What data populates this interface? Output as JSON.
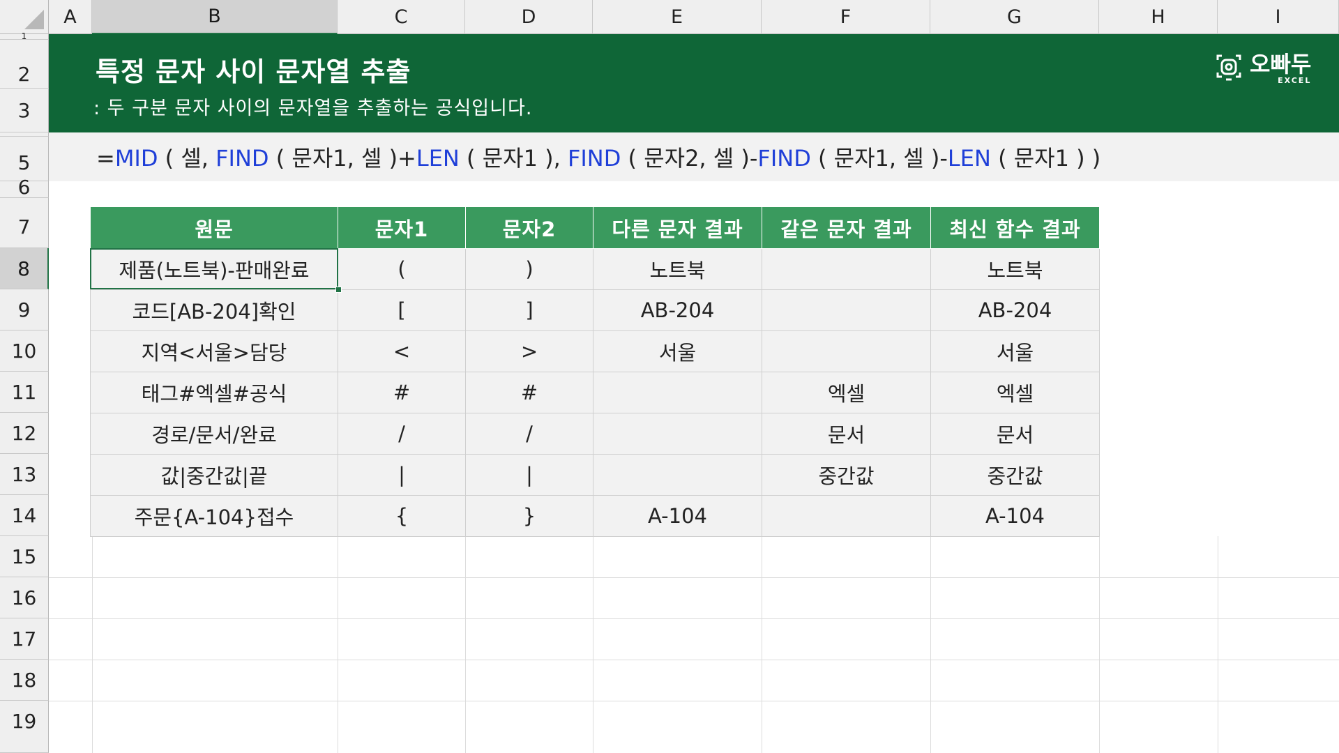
{
  "columns": [
    "A",
    "B",
    "C",
    "D",
    "E",
    "F",
    "G",
    "H",
    "I"
  ],
  "selected_column": "B",
  "rows": [
    "1",
    "2",
    "3",
    "5",
    "6",
    "7",
    "8",
    "9",
    "10",
    "11",
    "12",
    "13",
    "14",
    "15",
    "16",
    "17",
    "18",
    "19"
  ],
  "selected_row": "8",
  "banner": {
    "title": "특정 문자 사이 문자열 추출",
    "subtitle": ": 두 구분 문자 사이의 문자열을 추출하는 공식입니다.",
    "logo_name": "오빠두",
    "logo_sub": "EXCEL",
    "logo_icon": "camera-excel-logo-icon"
  },
  "formula": {
    "parts": [
      "=",
      "MID",
      " ( 셀, ",
      "FIND",
      " ( 문자1, 셀 )+",
      "LEN",
      " ( 문자1 ), ",
      "FIND",
      " ( 문자2, 셀 )-",
      "FIND",
      " ( 문자1, 셀 )-",
      "LEN",
      " ( 문자1 ) )"
    ]
  },
  "table": {
    "headers": [
      "원문",
      "문자1",
      "문자2",
      "다른 문자 결과",
      "같은 문자 결과",
      "최신 함수 결과"
    ],
    "rows": [
      [
        "제품(노트북)-판매완료",
        "(",
        ")",
        "노트북",
        "",
        "노트북"
      ],
      [
        "코드[AB-204]확인",
        "[",
        "]",
        "AB-204",
        "",
        "AB-204"
      ],
      [
        "지역<서울>담당",
        "<",
        ">",
        "서울",
        "",
        "서울"
      ],
      [
        "태그#엑셀#공식",
        "#",
        "#",
        "",
        "엑셀",
        "엑셀"
      ],
      [
        "경로/문서/완료",
        "/",
        "/",
        "",
        "문서",
        "문서"
      ],
      [
        "값|중간값|끝",
        "|",
        "|",
        "",
        "중간값",
        "중간값"
      ],
      [
        "주문{A-104}접수",
        "{",
        "}",
        "A-104",
        "",
        "A-104"
      ]
    ]
  },
  "colors": {
    "banner": "#0f6637",
    "header_fill": "#3a9a5e",
    "function_text": "#1f3fd8",
    "selection": "#217346"
  }
}
